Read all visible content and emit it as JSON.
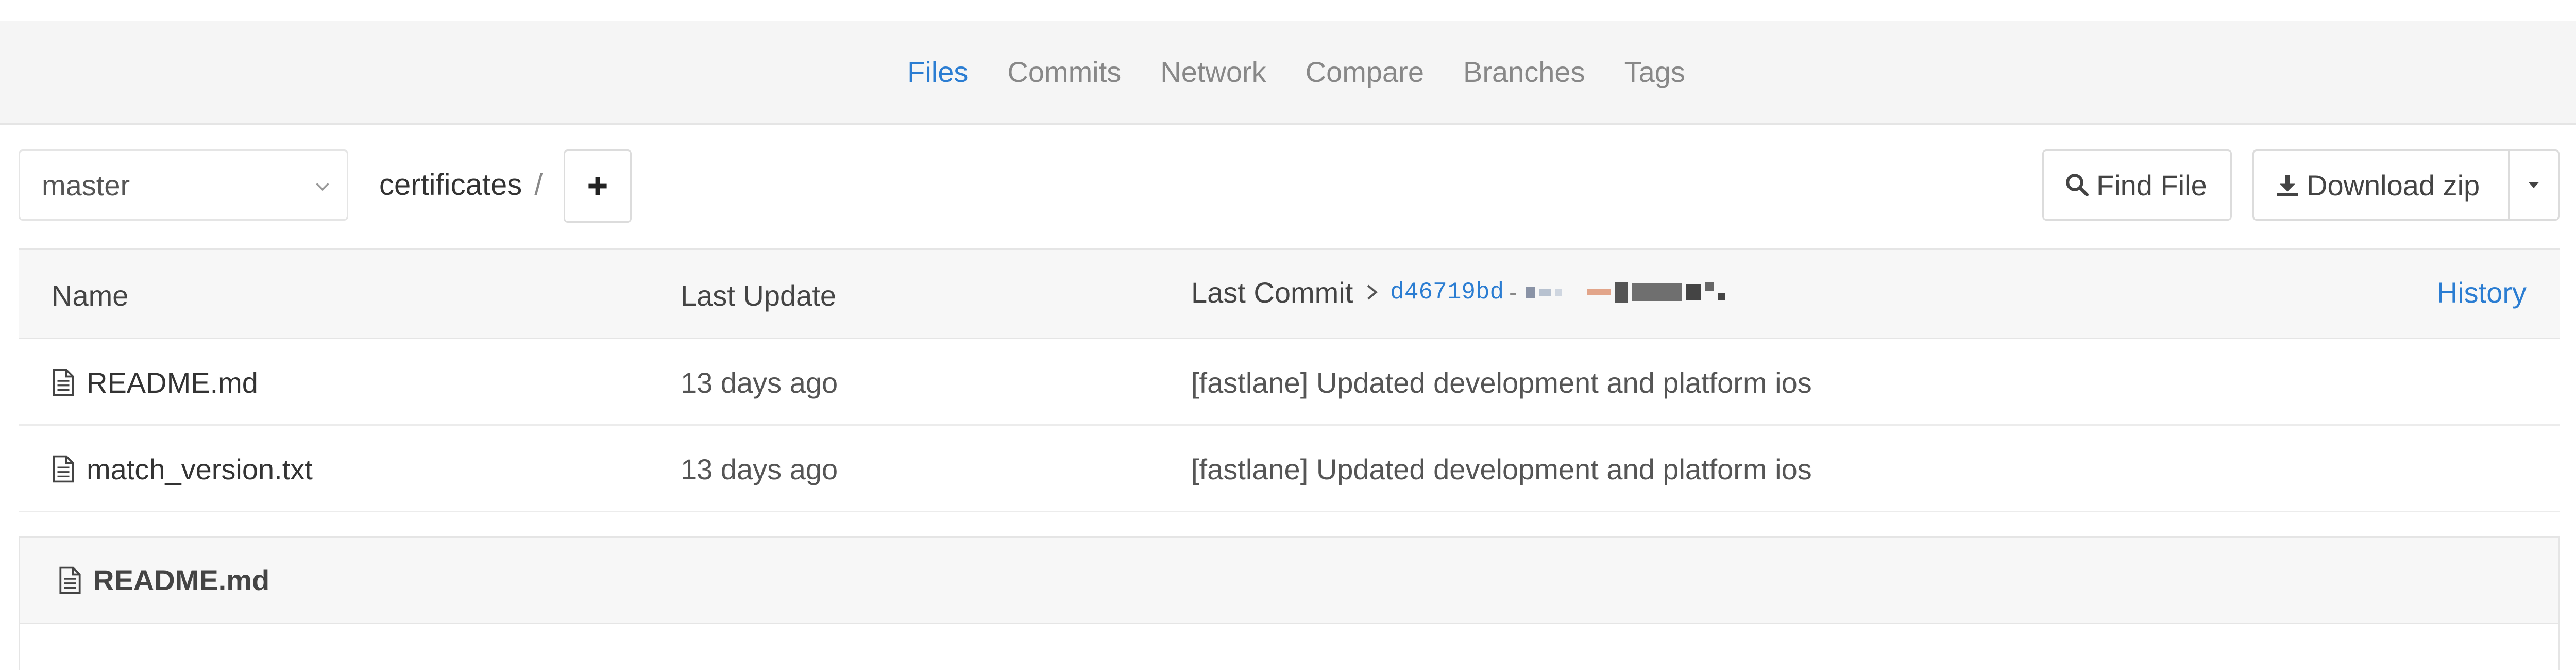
{
  "nav": {
    "tabs": [
      {
        "label": "Files",
        "active": true
      },
      {
        "label": "Commits",
        "active": false
      },
      {
        "label": "Network",
        "active": false
      },
      {
        "label": "Compare",
        "active": false
      },
      {
        "label": "Branches",
        "active": false
      },
      {
        "label": "Tags",
        "active": false
      }
    ]
  },
  "toolbar": {
    "branch": "master",
    "path": "certificates",
    "path_separator": "/",
    "add_icon": "plus-icon",
    "find_file_label": "Find File",
    "download_label": "Download zip"
  },
  "table": {
    "headers": {
      "name": "Name",
      "last_update": "Last Update",
      "last_commit": "Last Commit",
      "commit_sha": "d46719bd",
      "commit_dash": "-",
      "history": "History"
    },
    "rows": [
      {
        "name": "README.md",
        "updated": "13 days ago",
        "commit": "[fastlane] Updated development and platform ios",
        "icon": "file-text-icon"
      },
      {
        "name": "match_version.txt",
        "updated": "13 days ago",
        "commit": "[fastlane] Updated development and platform ios",
        "icon": "file-text-icon"
      }
    ]
  },
  "readme": {
    "title": "README.md"
  },
  "colors": {
    "accent": "#2b7dd2",
    "nav_bg": "#f5f5f5",
    "border": "#e5e5e5"
  }
}
